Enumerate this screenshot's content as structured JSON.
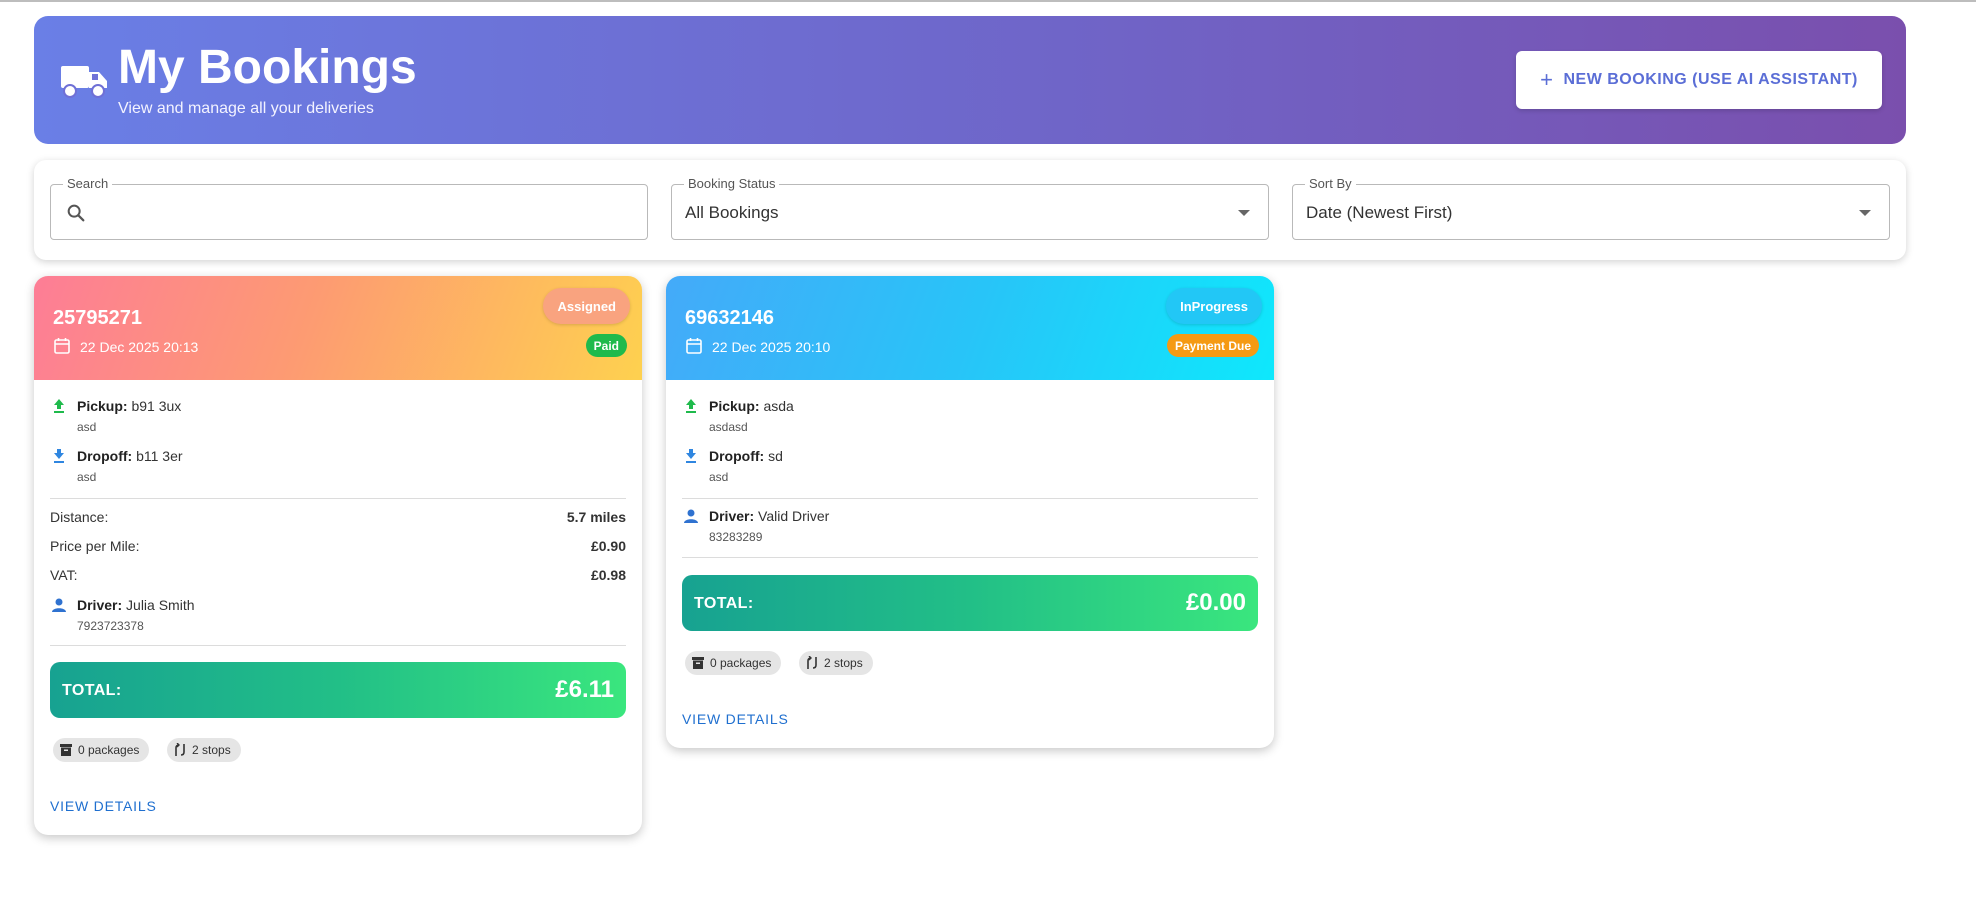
{
  "header": {
    "title": "My Bookings",
    "subtitle": "View and manage all your deliveries",
    "new_booking_label": "NEW BOOKING (USE AI ASSISTANT)",
    "icon": "truck-icon"
  },
  "filters": {
    "search": {
      "label": "Search",
      "value": "",
      "placeholder": ""
    },
    "status": {
      "label": "Booking Status",
      "value": "All Bookings"
    },
    "sort": {
      "label": "Sort By",
      "value": "Date (Newest First)"
    }
  },
  "colors": {
    "header_gradient": [
      "#6a7fe6",
      "#7a4fad"
    ],
    "total_gradient": [
      "#17a291",
      "#3ae67e"
    ],
    "paid": "#1fba4c",
    "payment_due": "#f59a13",
    "link": "#1f6fcf"
  },
  "bookings": [
    {
      "id": "25795271",
      "date": "22 Dec 2025 20:13",
      "status": "Assigned",
      "payment": "Paid",
      "pickup_label": "Pickup:",
      "pickup": "b91 3ux",
      "pickup_note": "asd",
      "dropoff_label": "Dropoff:",
      "dropoff": "b11 3er",
      "dropoff_note": "asd",
      "distance_label": "Distance:",
      "distance": "5.7 miles",
      "ppm_label": "Price per Mile:",
      "ppm": "£0.90",
      "vat_label": "VAT:",
      "vat": "£0.98",
      "driver_label": "Driver:",
      "driver": "Julia Smith",
      "driver_phone": "7923723378",
      "total_label": "TOTAL:",
      "total": "£6.11",
      "packages": "0 packages",
      "stops": "2 stops",
      "view_label": "VIEW DETAILS"
    },
    {
      "id": "69632146",
      "date": "22 Dec 2025 20:10",
      "status": "InProgress",
      "payment": "Payment Due",
      "pickup_label": "Pickup:",
      "pickup": "asda",
      "pickup_note": "asdasd",
      "dropoff_label": "Dropoff:",
      "dropoff": "sd",
      "dropoff_note": "asd",
      "driver_label": "Driver:",
      "driver": "Valid Driver",
      "driver_phone": "83283289",
      "total_label": "TOTAL:",
      "total": "£0.00",
      "packages": "0 packages",
      "stops": "2 stops",
      "view_label": "VIEW DETAILS"
    }
  ]
}
